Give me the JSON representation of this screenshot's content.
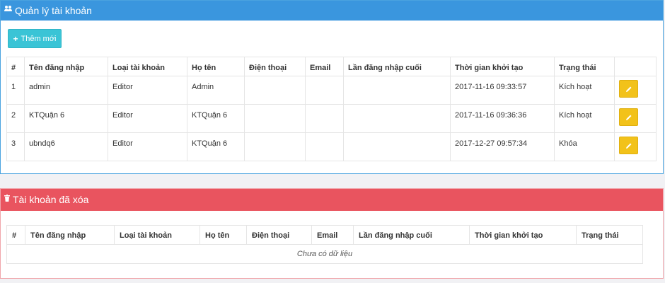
{
  "accounts_panel": {
    "title": "Quản lý tài khoản",
    "add_button": "Thêm mới",
    "columns": [
      "#",
      "Tên đăng nhập",
      "Loại tài khoản",
      "Họ tên",
      "Điện thoại",
      "Email",
      "Lần đăng nhập cuối",
      "Thời gian khởi tạo",
      "Trạng thái",
      ""
    ],
    "rows": [
      {
        "no": "1",
        "username": "admin",
        "type": "Editor",
        "fullname": "Admin",
        "phone": "",
        "email": "",
        "last_login": "",
        "created": "2017-11-16 09:33:57",
        "status": "Kích hoạt"
      },
      {
        "no": "2",
        "username": "KTQuận 6",
        "type": "Editor",
        "fullname": "KTQuận 6",
        "phone": "",
        "email": "",
        "last_login": "",
        "created": "2017-11-16 09:36:36",
        "status": "Kích hoạt"
      },
      {
        "no": "3",
        "username": "ubndq6",
        "type": "Editor",
        "fullname": "KTQuận 6",
        "phone": "",
        "email": "",
        "last_login": "",
        "created": "2017-12-27 09:57:34",
        "status": "Khóa"
      }
    ]
  },
  "deleted_panel": {
    "title": "Tài khoản đã xóa",
    "columns": [
      "#",
      "Tên đăng nhập",
      "Loại tài khoản",
      "Họ tên",
      "Điện thoại",
      "Email",
      "Lần đăng nhập cuối",
      "Thời gian khởi tạo",
      "Trạng thái"
    ],
    "empty_text": "Chưa có dữ liệu"
  },
  "colors": {
    "primary": "#3a96de",
    "danger": "#e9545f",
    "info": "#3ac4d6",
    "warning": "#f2c21a"
  },
  "icons": {
    "accounts": "users-icon",
    "deleted": "trash-icon",
    "add": "plus-icon",
    "edit": "pencil-icon"
  }
}
